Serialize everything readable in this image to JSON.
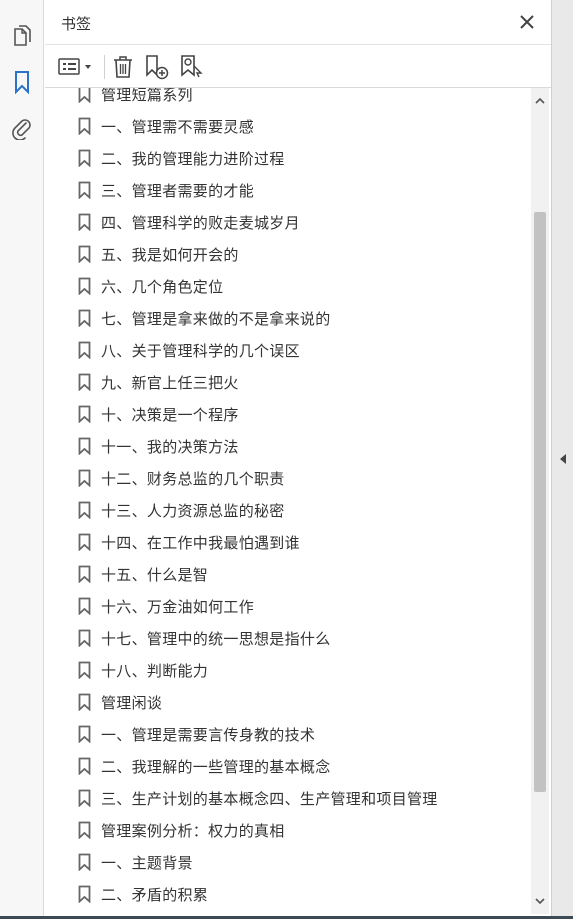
{
  "rail": {
    "items": [
      {
        "name": "pages",
        "icon": "pages-icon"
      },
      {
        "name": "bookmarks",
        "icon": "bookmark-icon",
        "active": true
      },
      {
        "name": "attachments",
        "icon": "paperclip-icon"
      }
    ],
    "active_color": "#2a73c9"
  },
  "panel": {
    "title": "书签",
    "close_icon": "close-icon"
  },
  "toolbar": {
    "options_icon": "options-list-icon",
    "delete_icon": "trash-icon",
    "new_icon": "new-bookmark-icon",
    "find_icon": "find-bookmark-icon"
  },
  "bookmarks": [
    "管理短篇系列",
    "一、管理需不需要灵感",
    "二、我的管理能力进阶过程",
    "三、管理者需要的才能",
    "四、管理科学的败走麦城岁月",
    "五、我是如何开会的",
    "六、几个角色定位",
    "七、管理是拿来做的不是拿来说的",
    "八、关于管理科学的几个误区",
    "九、新官上任三把火",
    "十、决策是一个程序",
    "十一、我的决策方法",
    "十二、财务总监的几个职责",
    "十三、人力资源总监的秘密",
    "十四、在工作中我最怕遇到谁",
    "十五、什么是智",
    "十六、万金油如何工作",
    "十七、管理中的统一思想是指什么",
    "十八、判断能力",
    "管理闲谈",
    "一、管理是需要言传身教的技术",
    "二、我理解的一些管理的基本概念",
    "三、生产计划的基本概念四、生产管理和项目管理",
    "管理案例分析：权力的真相",
    "一、主题背景",
    "二、矛盾的积累"
  ],
  "scrollbar": {
    "up_icon": "chevron-up-icon",
    "down_icon": "chevron-down-icon"
  },
  "splitter": {
    "collapse_icon": "triangle-left-icon"
  }
}
